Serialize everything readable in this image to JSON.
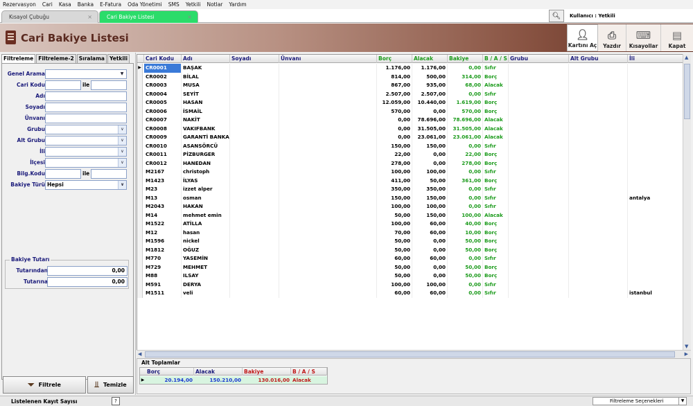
{
  "menu": [
    "Rezervasyon",
    "Cari",
    "Kasa",
    "Banka",
    "E-Fatura",
    "Oda Yönetimi",
    "SMS",
    "Yetkili",
    "Notlar",
    "Yardım"
  ],
  "tabs": [
    {
      "label": "Kısayol Çubuğu"
    },
    {
      "label": "Cari Bakiye Listesi"
    }
  ],
  "tab_close": "×",
  "user_label": "Kullanıcı : Yetkili",
  "page_title": "Cari Bakiye Listesi",
  "toolbar": {
    "open": "Kartını Aç",
    "print": "Yazdır",
    "shortcuts": "Kısayollar",
    "close": "Kapat"
  },
  "filter_tabs": [
    "Filtreleme",
    "Filtreleme-2",
    "Sıralama",
    "Yetkili"
  ],
  "filters": {
    "genel_arama": "Genel Arama",
    "cari_kodu": "Cari Kodu",
    "ile": "ile",
    "adi": "Adı",
    "soyadi": "Soyadı",
    "unvani": "Ünvanı",
    "grubu": "Grubu",
    "alt_grubu": "Alt Grubu",
    "ili": "İli",
    "ilcesi": "İlçesi",
    "bilg_kodu": "Bilg.Kodu",
    "bakiye_turu": "Bakiye Türü",
    "bakiye_turu_value": "Hepsi",
    "bakiye_tutari": "Bakiye Tutarı",
    "tutarindan": "Tutarından",
    "tutarindan_value": "0,00",
    "tutarina": "Tutarına",
    "tutarina_value": "0,00"
  },
  "buttons": {
    "filtrele": "Filtrele",
    "temizle": "Temizle"
  },
  "columns": [
    "Cari Kodu",
    "Adı",
    "Soyadı",
    "Ünvanı",
    "Borç",
    "Alacak",
    "Bakiye",
    "B / A / S",
    "Grubu",
    "Alt Grubu",
    "İli"
  ],
  "rows": [
    [
      "CR0001",
      "BAŞAK",
      "1.176,00",
      "1.176,00",
      "0,00",
      "Sıfır",
      ""
    ],
    [
      "CR0002",
      "BİLAL",
      "814,00",
      "500,00",
      "314,00",
      "Borç",
      ""
    ],
    [
      "CR0003",
      "MUSA",
      "867,00",
      "935,00",
      "68,00",
      "Alacak",
      ""
    ],
    [
      "CR0004",
      "SEYİT",
      "2.507,00",
      "2.507,00",
      "0,00",
      "Sıfır",
      ""
    ],
    [
      "CR0005",
      "HASAN",
      "12.059,00",
      "10.440,00",
      "1.619,00",
      "Borç",
      ""
    ],
    [
      "CR0006",
      "İSMAİL",
      "570,00",
      "0,00",
      "570,00",
      "Borç",
      ""
    ],
    [
      "CR0007",
      "NAKİT",
      "0,00",
      "78.696,00",
      "78.696,00",
      "Alacak",
      ""
    ],
    [
      "CR0008",
      "VAKIFBANK",
      "0,00",
      "31.505,00",
      "31.505,00",
      "Alacak",
      ""
    ],
    [
      "CR0009",
      "GARANTİ BANKAS",
      "0,00",
      "23.061,00",
      "23.061,00",
      "Alacak",
      ""
    ],
    [
      "CR0010",
      "ASANSÖRCÜ",
      "150,00",
      "150,00",
      "0,00",
      "Sıfır",
      ""
    ],
    [
      "CR0011",
      "PİZBURGER",
      "22,00",
      "0,00",
      "22,00",
      "Borç",
      ""
    ],
    [
      "CR0012",
      "HANEDAN",
      "278,00",
      "0,00",
      "278,00",
      "Borç",
      ""
    ],
    [
      "M2167",
      "christoph",
      "100,00",
      "100,00",
      "0,00",
      "Sıfır",
      ""
    ],
    [
      "M1423",
      "İLYAS",
      "411,00",
      "50,00",
      "361,00",
      "Borç",
      ""
    ],
    [
      "M23",
      "izzet alper",
      "350,00",
      "350,00",
      "0,00",
      "Sıfır",
      ""
    ],
    [
      "M13",
      "osman",
      "150,00",
      "150,00",
      "0,00",
      "Sıfır",
      "antalya"
    ],
    [
      "M2043",
      "HAKAN",
      "100,00",
      "100,00",
      "0,00",
      "Sıfır",
      ""
    ],
    [
      "M14",
      "mehmet emin",
      "50,00",
      "150,00",
      "100,00",
      "Alacak",
      ""
    ],
    [
      "M1522",
      "ATİLLA",
      "100,00",
      "60,00",
      "40,00",
      "Borç",
      ""
    ],
    [
      "M12",
      "hasan",
      "70,00",
      "60,00",
      "10,00",
      "Borç",
      ""
    ],
    [
      "M1596",
      "nickel",
      "50,00",
      "0,00",
      "50,00",
      "Borç",
      ""
    ],
    [
      "M1812",
      "OĞUZ",
      "50,00",
      "0,00",
      "50,00",
      "Borç",
      ""
    ],
    [
      "M770",
      "YASEMİN",
      "60,00",
      "60,00",
      "0,00",
      "Sıfır",
      ""
    ],
    [
      "M729",
      "MEHMET",
      "50,00",
      "0,00",
      "50,00",
      "Borç",
      ""
    ],
    [
      "M88",
      "ILSAY",
      "50,00",
      "0,00",
      "50,00",
      "Borç",
      ""
    ],
    [
      "M591",
      "DERYA",
      "100,00",
      "100,00",
      "0,00",
      "Sıfır",
      ""
    ],
    [
      "M1511",
      "veli",
      "60,00",
      "60,00",
      "0,00",
      "Sıfır",
      "istanbul"
    ]
  ],
  "totals": {
    "label": "Alt Toplamlar",
    "headers": [
      "Borç",
      "Alacak",
      "Bakiye",
      "B / A / S"
    ],
    "values": [
      "20.194,00",
      "150.210,00",
      "130.016,00",
      "Alacak"
    ]
  },
  "status": {
    "label": "Listelenen Kayıt Sayısı",
    "help": "?",
    "dropdown": "Filtreleme Seçenekleri"
  }
}
